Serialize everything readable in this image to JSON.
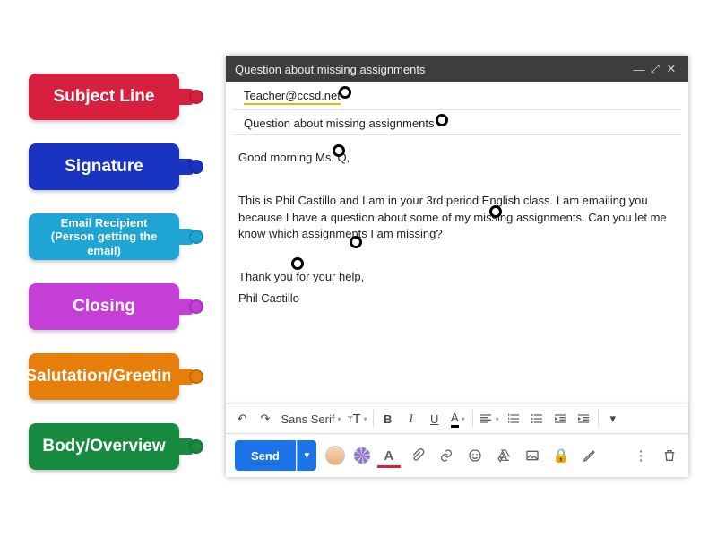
{
  "labels": [
    {
      "text": "Subject Line",
      "color": "red"
    },
    {
      "text": "Signature",
      "color": "blue"
    },
    {
      "text": "Email Recipient (Person getting the email)",
      "color": "cyan",
      "threeline": true
    },
    {
      "text": "Closing",
      "color": "magenta"
    },
    {
      "text": "Salutation/Greeting",
      "color": "orange"
    },
    {
      "text": "Body/Overview",
      "color": "green"
    }
  ],
  "compose": {
    "window_title": "Question about missing assignments",
    "recipient": "Teacher@ccsd.net",
    "subject": "Question about missing assignments",
    "greeting": "Good morning Ms. Q,",
    "body": "This is Phil Castillo and I am in your 3rd period English class. I am emailing you because I have a question about some of my missing assignments. Can you let me know which assignments I am missing?",
    "closing": "Thank you for your help,",
    "signature": "Phil Castillo",
    "font_name": "Sans Serif",
    "send_label": "Send"
  },
  "toolbar": {
    "undo": "↶",
    "redo": "↷",
    "font_size": "тT",
    "bold": "B",
    "italic": "I",
    "underline": "U",
    "text_color": "A"
  }
}
